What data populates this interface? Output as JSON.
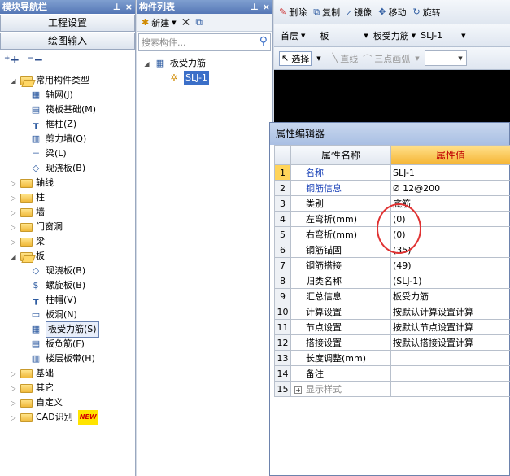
{
  "left_panel": {
    "title": "模块导航栏",
    "pin_icon": "pin-icon",
    "close_label": "×",
    "buttons": [
      "工程设置",
      "绘图输入"
    ],
    "tree": [
      {
        "label": "常用构件类型",
        "type": "folder-open",
        "level": 0,
        "expanded": true
      },
      {
        "label": "轴网(J)",
        "type": "grid-icon",
        "level": 1
      },
      {
        "label": "筏板基础(M)",
        "type": "raft-icon",
        "level": 1
      },
      {
        "label": "框柱(Z)",
        "type": "column-icon",
        "level": 1
      },
      {
        "label": "剪力墙(Q)",
        "type": "wall-icon",
        "level": 1
      },
      {
        "label": "梁(L)",
        "type": "beam-icon",
        "level": 1
      },
      {
        "label": "现浇板(B)",
        "type": "slab-icon",
        "level": 1
      },
      {
        "label": "轴线",
        "type": "folder",
        "level": 0
      },
      {
        "label": "柱",
        "type": "folder",
        "level": 0
      },
      {
        "label": "墙",
        "type": "folder",
        "level": 0
      },
      {
        "label": "门窗洞",
        "type": "folder",
        "level": 0
      },
      {
        "label": "梁",
        "type": "folder",
        "level": 0
      },
      {
        "label": "板",
        "type": "folder-open",
        "level": 0,
        "expanded": true
      },
      {
        "label": "现浇板(B)",
        "type": "slab-icon",
        "level": 1
      },
      {
        "label": "螺旋板(B)",
        "type": "spiral-icon",
        "level": 1
      },
      {
        "label": "柱帽(V)",
        "type": "capital-icon",
        "level": 1
      },
      {
        "label": "板洞(N)",
        "type": "hole-icon",
        "level": 1
      },
      {
        "label": "板受力筋(S)",
        "type": "rebar-icon",
        "level": 1,
        "selected": true
      },
      {
        "label": "板负筋(F)",
        "type": "neg-rebar-icon",
        "level": 1
      },
      {
        "label": "楼层板带(H)",
        "type": "band-icon",
        "level": 1
      },
      {
        "label": "基础",
        "type": "folder",
        "level": 0
      },
      {
        "label": "其它",
        "type": "folder",
        "level": 0
      },
      {
        "label": "自定义",
        "type": "folder",
        "level": 0
      },
      {
        "label": "CAD识别",
        "type": "folder",
        "level": 0,
        "badge": "NEW"
      }
    ]
  },
  "mid_panel": {
    "title": "构件列表",
    "new_label": "新建",
    "search_placeholder": "搜索构件...",
    "tree_root": "板受力筋",
    "tree_child": "SLJ-1"
  },
  "toolbar1": {
    "delete": "删除",
    "copy": "复制",
    "mirror": "镜像",
    "move": "移动",
    "rotate": "旋转"
  },
  "toolbar2": {
    "floor": "首层",
    "category": "板",
    "type": "板受力筋",
    "name": "SLJ-1"
  },
  "toolbar3": {
    "select": "选择",
    "line": "直线",
    "arc": "三点画弧"
  },
  "property_editor": {
    "title": "属性编辑器",
    "col_name": "属性名称",
    "col_value": "属性值",
    "rows": [
      {
        "num": "1",
        "name": "名称",
        "value": "SLJ-1",
        "style": "blue"
      },
      {
        "num": "2",
        "name": "钢筋信息",
        "value": "Ø 12@200",
        "style": "blue"
      },
      {
        "num": "3",
        "name": "类别",
        "value": "底筋",
        "style": ""
      },
      {
        "num": "4",
        "name": "左弯折(mm)",
        "value": "(0)",
        "style": ""
      },
      {
        "num": "5",
        "name": "右弯折(mm)",
        "value": "(0)",
        "style": ""
      },
      {
        "num": "6",
        "name": "钢筋锚固",
        "value": "(35)",
        "style": ""
      },
      {
        "num": "7",
        "name": "钢筋搭接",
        "value": "(49)",
        "style": ""
      },
      {
        "num": "8",
        "name": "归类名称",
        "value": "(SLJ-1)",
        "style": ""
      },
      {
        "num": "9",
        "name": "汇总信息",
        "value": "板受力筋",
        "style": ""
      },
      {
        "num": "10",
        "name": "计算设置",
        "value": "按默认计算设置计算",
        "style": ""
      },
      {
        "num": "11",
        "name": "节点设置",
        "value": "按默认节点设置计算",
        "style": ""
      },
      {
        "num": "12",
        "name": "搭接设置",
        "value": "按默认搭接设置计算",
        "style": ""
      },
      {
        "num": "13",
        "name": "长度调整(mm)",
        "value": "",
        "style": ""
      },
      {
        "num": "14",
        "name": "备注",
        "value": "",
        "style": ""
      },
      {
        "num": "15",
        "name": "显示样式",
        "value": "",
        "style": "gray"
      }
    ]
  },
  "colors": {
    "accent": "#3b6fc8",
    "header_value": "#f5b433",
    "annotation": "#e03232"
  }
}
